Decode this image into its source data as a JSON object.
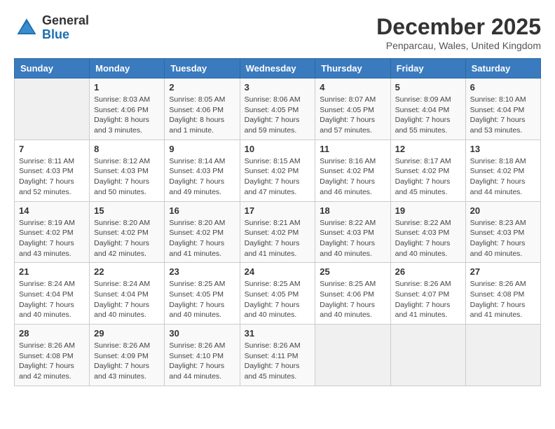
{
  "header": {
    "logo_general": "General",
    "logo_blue": "Blue",
    "month_title": "December 2025",
    "location": "Penparcau, Wales, United Kingdom"
  },
  "days_of_week": [
    "Sunday",
    "Monday",
    "Tuesday",
    "Wednesday",
    "Thursday",
    "Friday",
    "Saturday"
  ],
  "weeks": [
    [
      {
        "day": "",
        "info": ""
      },
      {
        "day": "1",
        "info": "Sunrise: 8:03 AM\nSunset: 4:06 PM\nDaylight: 8 hours\nand 3 minutes."
      },
      {
        "day": "2",
        "info": "Sunrise: 8:05 AM\nSunset: 4:06 PM\nDaylight: 8 hours\nand 1 minute."
      },
      {
        "day": "3",
        "info": "Sunrise: 8:06 AM\nSunset: 4:05 PM\nDaylight: 7 hours\nand 59 minutes."
      },
      {
        "day": "4",
        "info": "Sunrise: 8:07 AM\nSunset: 4:05 PM\nDaylight: 7 hours\nand 57 minutes."
      },
      {
        "day": "5",
        "info": "Sunrise: 8:09 AM\nSunset: 4:04 PM\nDaylight: 7 hours\nand 55 minutes."
      },
      {
        "day": "6",
        "info": "Sunrise: 8:10 AM\nSunset: 4:04 PM\nDaylight: 7 hours\nand 53 minutes."
      }
    ],
    [
      {
        "day": "7",
        "info": "Sunrise: 8:11 AM\nSunset: 4:03 PM\nDaylight: 7 hours\nand 52 minutes."
      },
      {
        "day": "8",
        "info": "Sunrise: 8:12 AM\nSunset: 4:03 PM\nDaylight: 7 hours\nand 50 minutes."
      },
      {
        "day": "9",
        "info": "Sunrise: 8:14 AM\nSunset: 4:03 PM\nDaylight: 7 hours\nand 49 minutes."
      },
      {
        "day": "10",
        "info": "Sunrise: 8:15 AM\nSunset: 4:02 PM\nDaylight: 7 hours\nand 47 minutes."
      },
      {
        "day": "11",
        "info": "Sunrise: 8:16 AM\nSunset: 4:02 PM\nDaylight: 7 hours\nand 46 minutes."
      },
      {
        "day": "12",
        "info": "Sunrise: 8:17 AM\nSunset: 4:02 PM\nDaylight: 7 hours\nand 45 minutes."
      },
      {
        "day": "13",
        "info": "Sunrise: 8:18 AM\nSunset: 4:02 PM\nDaylight: 7 hours\nand 44 minutes."
      }
    ],
    [
      {
        "day": "14",
        "info": "Sunrise: 8:19 AM\nSunset: 4:02 PM\nDaylight: 7 hours\nand 43 minutes."
      },
      {
        "day": "15",
        "info": "Sunrise: 8:20 AM\nSunset: 4:02 PM\nDaylight: 7 hours\nand 42 minutes."
      },
      {
        "day": "16",
        "info": "Sunrise: 8:20 AM\nSunset: 4:02 PM\nDaylight: 7 hours\nand 41 minutes."
      },
      {
        "day": "17",
        "info": "Sunrise: 8:21 AM\nSunset: 4:02 PM\nDaylight: 7 hours\nand 41 minutes."
      },
      {
        "day": "18",
        "info": "Sunrise: 8:22 AM\nSunset: 4:03 PM\nDaylight: 7 hours\nand 40 minutes."
      },
      {
        "day": "19",
        "info": "Sunrise: 8:22 AM\nSunset: 4:03 PM\nDaylight: 7 hours\nand 40 minutes."
      },
      {
        "day": "20",
        "info": "Sunrise: 8:23 AM\nSunset: 4:03 PM\nDaylight: 7 hours\nand 40 minutes."
      }
    ],
    [
      {
        "day": "21",
        "info": "Sunrise: 8:24 AM\nSunset: 4:04 PM\nDaylight: 7 hours\nand 40 minutes."
      },
      {
        "day": "22",
        "info": "Sunrise: 8:24 AM\nSunset: 4:04 PM\nDaylight: 7 hours\nand 40 minutes."
      },
      {
        "day": "23",
        "info": "Sunrise: 8:25 AM\nSunset: 4:05 PM\nDaylight: 7 hours\nand 40 minutes."
      },
      {
        "day": "24",
        "info": "Sunrise: 8:25 AM\nSunset: 4:05 PM\nDaylight: 7 hours\nand 40 minutes."
      },
      {
        "day": "25",
        "info": "Sunrise: 8:25 AM\nSunset: 4:06 PM\nDaylight: 7 hours\nand 40 minutes."
      },
      {
        "day": "26",
        "info": "Sunrise: 8:26 AM\nSunset: 4:07 PM\nDaylight: 7 hours\nand 41 minutes."
      },
      {
        "day": "27",
        "info": "Sunrise: 8:26 AM\nSunset: 4:08 PM\nDaylight: 7 hours\nand 41 minutes."
      }
    ],
    [
      {
        "day": "28",
        "info": "Sunrise: 8:26 AM\nSunset: 4:08 PM\nDaylight: 7 hours\nand 42 minutes."
      },
      {
        "day": "29",
        "info": "Sunrise: 8:26 AM\nSunset: 4:09 PM\nDaylight: 7 hours\nand 43 minutes."
      },
      {
        "day": "30",
        "info": "Sunrise: 8:26 AM\nSunset: 4:10 PM\nDaylight: 7 hours\nand 44 minutes."
      },
      {
        "day": "31",
        "info": "Sunrise: 8:26 AM\nSunset: 4:11 PM\nDaylight: 7 hours\nand 45 minutes."
      },
      {
        "day": "",
        "info": ""
      },
      {
        "day": "",
        "info": ""
      },
      {
        "day": "",
        "info": ""
      }
    ]
  ]
}
